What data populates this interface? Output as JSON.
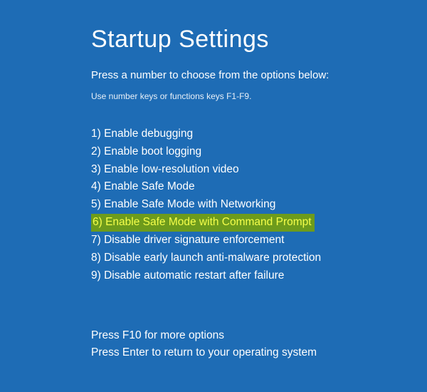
{
  "title": "Startup Settings",
  "subtitle": "Press a number to choose from the options below:",
  "hint": "Use number keys or functions keys F1-F9.",
  "options": [
    {
      "num": "1)",
      "label": "Enable debugging",
      "highlighted": false
    },
    {
      "num": "2)",
      "label": "Enable boot logging",
      "highlighted": false
    },
    {
      "num": "3)",
      "label": "Enable low-resolution video",
      "highlighted": false
    },
    {
      "num": "4)",
      "label": "Enable Safe Mode",
      "highlighted": false
    },
    {
      "num": "5)",
      "label": "Enable Safe Mode with Networking",
      "highlighted": false
    },
    {
      "num": "6)",
      "label": "Enable Safe Mode with Command Prompt",
      "highlighted": true
    },
    {
      "num": "7)",
      "label": "Disable driver signature enforcement",
      "highlighted": false
    },
    {
      "num": "8)",
      "label": "Disable early launch anti-malware protection",
      "highlighted": false
    },
    {
      "num": "9)",
      "label": "Disable automatic restart after failure",
      "highlighted": false
    }
  ],
  "footer": {
    "line1": "Press F10 for more options",
    "line2": "Press Enter to return to your operating system"
  },
  "colors": {
    "background": "#1e6cb5",
    "text": "#ffffff",
    "highlight_bg": "#6d9b1c",
    "highlight_fg": "#f5ff4a"
  }
}
